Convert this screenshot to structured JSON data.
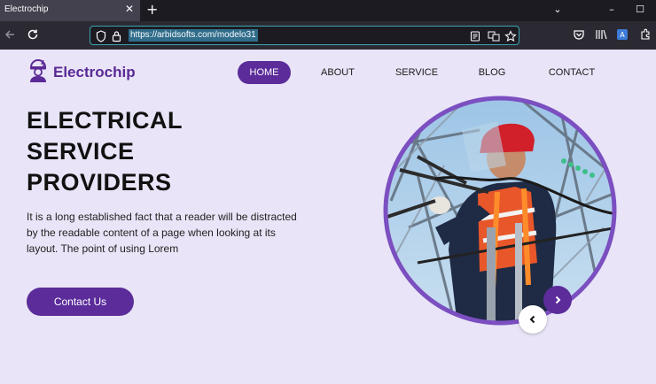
{
  "browser": {
    "tab_title": "Electrochip",
    "tab_close": "✕",
    "new_tab": "+",
    "url": "https://arbidsofts.com/modelo31"
  },
  "site": {
    "logo_text": "Electrochip",
    "nav": [
      "HOME",
      "ABOUT",
      "SERVICE",
      "BLOG",
      "CONTACT"
    ],
    "active_nav": "HOME"
  },
  "hero": {
    "headline_lines": [
      "ELECTRICAL",
      "SERVICE",
      "PROVIDERS"
    ],
    "description": "It is a long established fact that a reader will be distracted by the readable content of a page when looking at its layout. The point of using Lorem",
    "cta_label": "Contact Us"
  },
  "colors": {
    "brand_purple": "#5b2c9a",
    "page_bg": "#e9e4f7",
    "circle_border": "#7b4fc0"
  }
}
